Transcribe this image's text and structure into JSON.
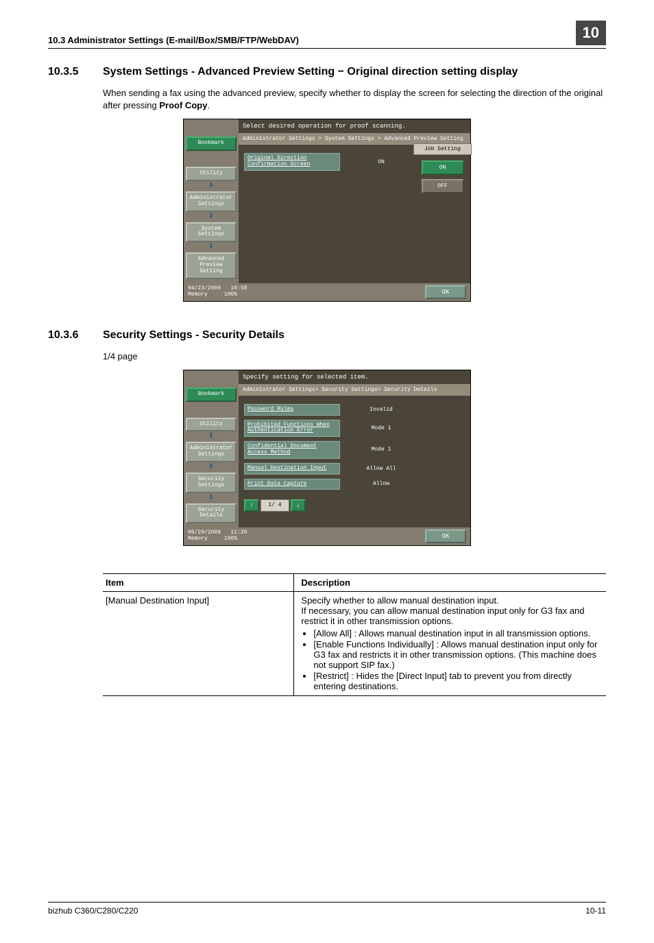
{
  "header": {
    "left": "10.3    Administrator Settings (E-mail/Box/SMB/FTP/WebDAV)",
    "right": "10"
  },
  "section1": {
    "number": "10.3.5",
    "title": "System Settings - Advanced Preview Setting − Original direction setting display",
    "body_pre": "When sending a fax using the advanced preview, specify whether to display the screen for selecting the direction of the original after pressing ",
    "body_bold": "Proof Copy",
    "body_post": "."
  },
  "panel1": {
    "top_msg": "Select desired operation for proof scanning.",
    "breadcrumb": "Administrator Settings > System Settings > Advanced Preview Setting",
    "sidebar": {
      "bookmark": "Bookmark",
      "items": [
        "Utility",
        "Administrator Settings",
        "System Settings",
        "Advanced Preview Setting"
      ]
    },
    "option": {
      "label_l1": "Original Direction",
      "label_l2": "Confirmation Screen",
      "value": "ON"
    },
    "side": {
      "title": "Job Setting",
      "on": "ON",
      "off": "OFF"
    },
    "footer": {
      "date": "04/23/2009",
      "time": "10:58",
      "mem_label": "Memory",
      "mem_val": "100%",
      "ok": "OK"
    }
  },
  "section2": {
    "number": "10.3.6",
    "title": "Security Settings - Security Details",
    "note": "1/4 page"
  },
  "panel2": {
    "top_msg": "Specify setting for selected item.",
    "breadcrumb": "Administrator Settings> Security Settings> Security Details",
    "sidebar": {
      "bookmark": "Bookmark",
      "items": [
        "Utility",
        "Administrator Settings",
        "Security Settings",
        "Security Details"
      ]
    },
    "rows": [
      {
        "label": "Password Rules",
        "value": "Invalid"
      },
      {
        "label": "Prohibited Functions When Authentication Error",
        "value": "Mode 1"
      },
      {
        "label": "Confidential Document Access Method",
        "value": "Mode 1"
      },
      {
        "label": "Manual Destination Input",
        "value": "Allow All"
      },
      {
        "label": "Print Data Capture",
        "value": "Allow"
      }
    ],
    "pager": "1/ 4",
    "footer": {
      "date": "09/29/2009",
      "time": "11:20",
      "mem_label": "Memory",
      "mem_val": "100%",
      "ok": "OK"
    }
  },
  "table": {
    "headers": [
      "Item",
      "Description"
    ],
    "item": "[Manual Destination Input]",
    "desc_intro": "Specify whether to allow manual destination input.\nIf necessary, you can allow manual destination input only for G3 fax and restrict it in other transmission options.",
    "bullets": [
      "[Allow All] : Allows manual destination input in all transmission options.",
      "[Enable Functions Individually] : Allows manual destination input only for G3 fax and restricts it in other transmission options. (This machine does not support SIP fax.)",
      "[Restrict] : Hides the [Direct Input] tab to prevent you from directly entering destinations."
    ]
  },
  "footer": {
    "left": "bizhub C360/C280/C220",
    "right": "10-11"
  }
}
